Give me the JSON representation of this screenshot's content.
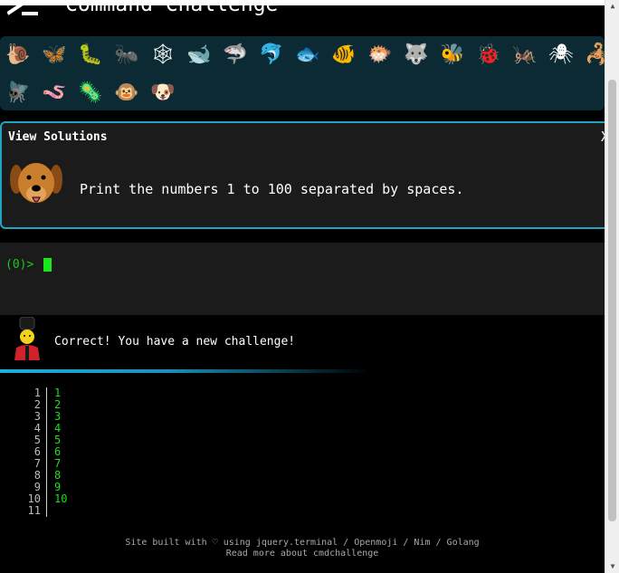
{
  "app": {
    "title": "Command Challenge"
  },
  "emojis": [
    {
      "name": "snail-icon",
      "glyph": "🐌"
    },
    {
      "name": "butterfly-icon",
      "glyph": "🦋"
    },
    {
      "name": "caterpillar-icon",
      "glyph": "🐛"
    },
    {
      "name": "ant-icon",
      "glyph": "🐜"
    },
    {
      "name": "spider-web-icon",
      "glyph": "🕸"
    },
    {
      "name": "whale-icon",
      "glyph": "🐋"
    },
    {
      "name": "shark-icon",
      "glyph": "🦈"
    },
    {
      "name": "dolphin-icon",
      "glyph": "🐬"
    },
    {
      "name": "fish-icon",
      "glyph": "🐟"
    },
    {
      "name": "tropical-fish-icon",
      "glyph": "🐠"
    },
    {
      "name": "blowfish-icon",
      "glyph": "🐡"
    },
    {
      "name": "wolf-icon",
      "glyph": "🐺"
    },
    {
      "name": "bee-icon",
      "glyph": "🐝"
    },
    {
      "name": "ladybug-icon",
      "glyph": "🐞"
    },
    {
      "name": "cricket-icon",
      "glyph": "🦗"
    },
    {
      "name": "spider-icon",
      "glyph": "🕷"
    },
    {
      "name": "scorpion-icon",
      "glyph": "🦂"
    },
    {
      "name": "fly-icon",
      "glyph": "🪰"
    },
    {
      "name": "worm-icon",
      "glyph": "🪱"
    },
    {
      "name": "microbe-icon",
      "glyph": "🦠"
    },
    {
      "name": "chimpanzee-icon",
      "glyph": "🐵"
    },
    {
      "name": "dog-icon",
      "glyph": "🐶"
    }
  ],
  "solution": {
    "heading": "View Solutions",
    "close_label": "X",
    "challenge_text": "Print the numbers 1 to 100 separated by spaces."
  },
  "terminal": {
    "prompt": "(0)>"
  },
  "status": {
    "message": "Correct! You have a new challenge!"
  },
  "output": {
    "line_numbers": [
      "1",
      "2",
      "3",
      "4",
      "5",
      "6",
      "7",
      "8",
      "9",
      "10",
      "11"
    ],
    "values": [
      "1",
      "2",
      "3",
      "4",
      "5",
      "6",
      "7",
      "8",
      "9",
      "10",
      ""
    ]
  },
  "footer": {
    "line1_prefix": "Site built with",
    "heart": "♡",
    "line1_suffix": "using jquery.terminal / Openmoji / Nim / Golang",
    "line2": "Read more about cmdchallenge"
  },
  "colors": {
    "accent": "#23a4c4",
    "prompt": "#19c919",
    "panel": "#1b1b1b",
    "emoji_bar": "#0b2a33"
  }
}
